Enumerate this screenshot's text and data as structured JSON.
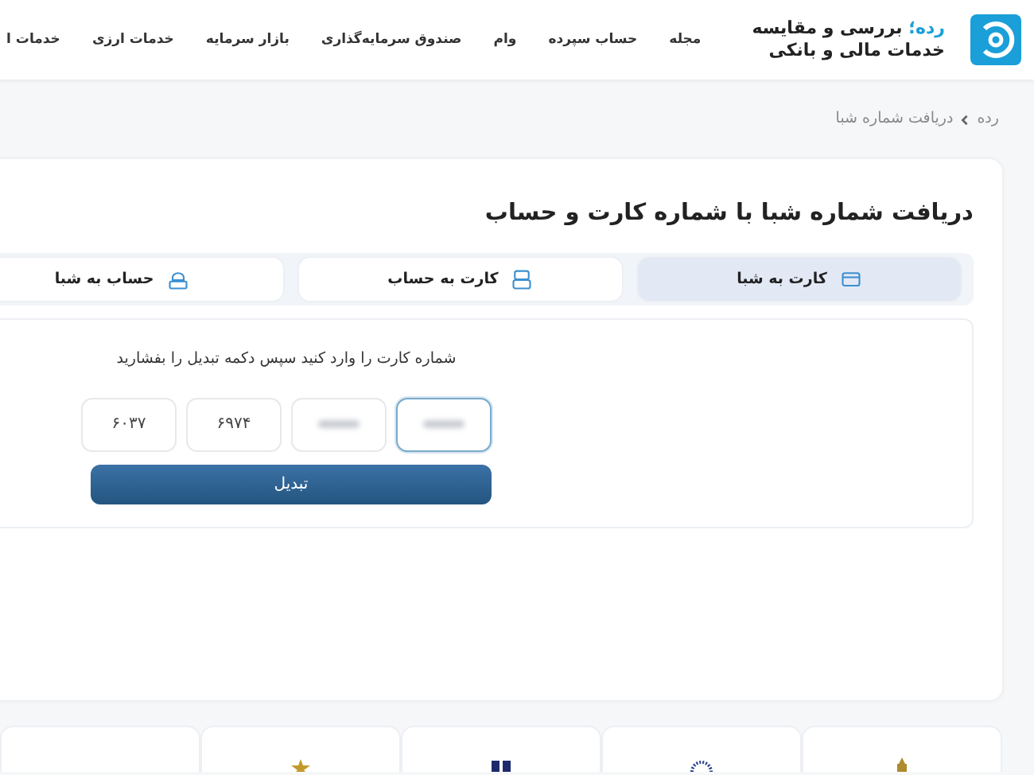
{
  "header": {
    "brand": "رده؛",
    "tagline_1": "بررسی و مقایسه",
    "tagline_2": "خدمات مالی و بانکی",
    "nav": [
      "مجله",
      "حساب سپرده",
      "وام",
      "صندوق سرمایه‌گذاری",
      "بازار سرمایه",
      "خدمات ارزی",
      "خدمات ا"
    ]
  },
  "breadcrumb": [
    "رده",
    "دریافت شماره شبا"
  ],
  "title": "دریافت شماره شبا با شماره کارت و حساب",
  "tabs": [
    {
      "label": "کارت به شبا",
      "selected": true
    },
    {
      "label": "کارت به حساب",
      "selected": false
    },
    {
      "label": "حساب به شبا",
      "selected": false
    }
  ],
  "form": {
    "instruction": "شماره کارت را وارد کنید سپس دکمه تبدیل را بفشارید",
    "fields": [
      {
        "blurred": true,
        "focused": true
      },
      {
        "blurred": true,
        "focused": false
      },
      {
        "value": "۶۹۷۴",
        "blurred": false,
        "focused": false
      },
      {
        "value": "۶۰۳۷",
        "blurred": false,
        "focused": false
      }
    ],
    "button": "تبدیل"
  },
  "bank_cards": [
    {
      "kind": "emblem"
    },
    {
      "kind": "sun"
    },
    {
      "kind": "letters"
    },
    {
      "kind": "star"
    },
    {
      "kind": "blank"
    }
  ]
}
